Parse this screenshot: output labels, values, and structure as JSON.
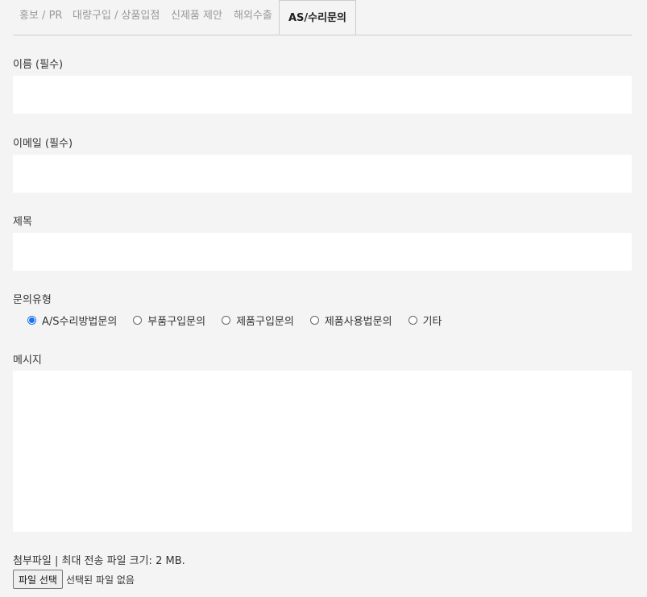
{
  "tabs": [
    {
      "label": "홍보 / PR"
    },
    {
      "label": "대량구입 / 상품입점"
    },
    {
      "label": "신제품 제안"
    },
    {
      "label": "해외수출"
    },
    {
      "label": "AS/수리문의"
    }
  ],
  "form": {
    "name_label": "이름 (필수)",
    "name_value": "",
    "email_label": "이메일 (필수)",
    "email_value": "",
    "subject_label": "제목",
    "subject_value": "",
    "inquiry_type_label": "문의유형",
    "inquiry_options": [
      {
        "label": "A/S수리방법문의",
        "checked": true
      },
      {
        "label": "부품구입문의",
        "checked": false
      },
      {
        "label": "제품구입문의",
        "checked": false
      },
      {
        "label": "제품사용법문의",
        "checked": false
      },
      {
        "label": "기타",
        "checked": false
      }
    ],
    "message_label": "메시지",
    "message_value": "",
    "attachment_label": "첨부파일 | 최대 전송 파일 크기: 2 MB.",
    "file_button_label": "파일 선택",
    "file_status": "선택된 파일 없음"
  },
  "colors": {
    "background": "#f4f4f4",
    "radio_accent": "#1a73e8"
  }
}
